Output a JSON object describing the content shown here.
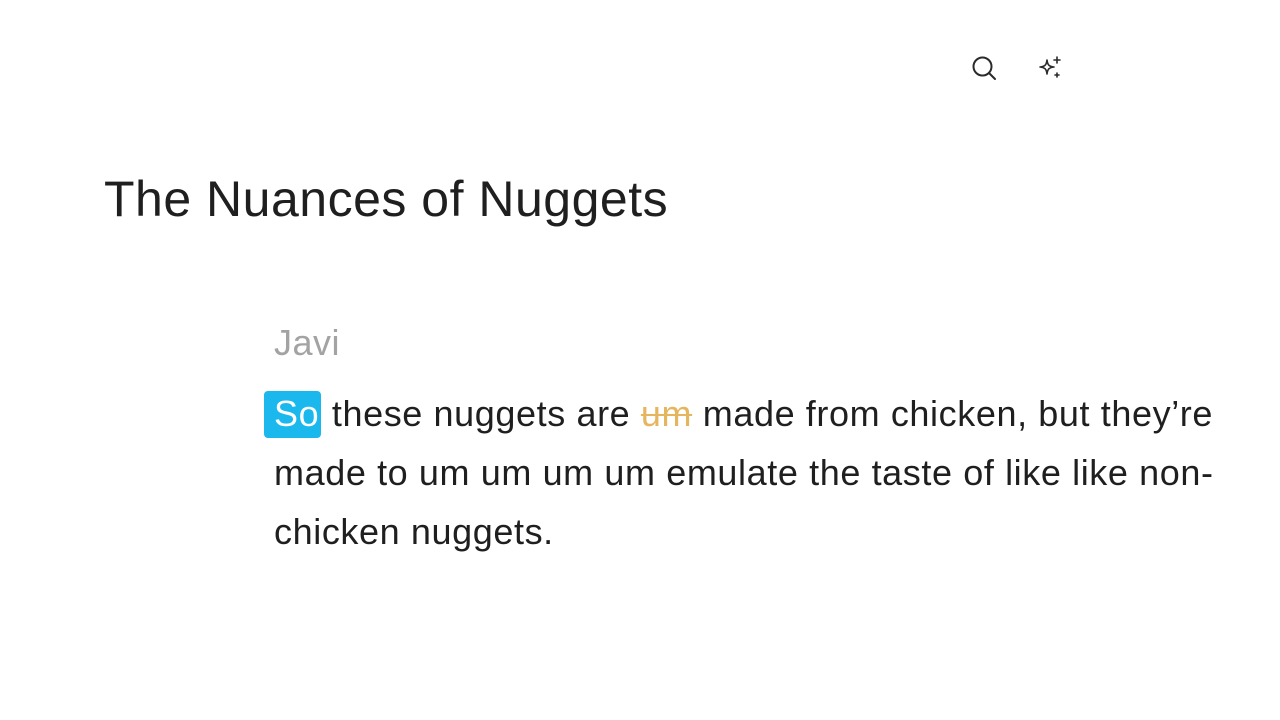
{
  "toolbar": {
    "search_icon": "search-icon",
    "ai_icon": "sparkle-icon"
  },
  "document": {
    "title": "The Nuances of Nuggets"
  },
  "transcript": {
    "speaker": "Javi",
    "words": [
      {
        "text": "So",
        "state": "selected"
      },
      {
        "text": "these",
        "state": "normal"
      },
      {
        "text": "nuggets",
        "state": "normal"
      },
      {
        "text": "are",
        "state": "normal"
      },
      {
        "text": "um",
        "state": "filler"
      },
      {
        "text": "made",
        "state": "normal"
      },
      {
        "text": "from",
        "state": "normal"
      },
      {
        "text": "chicken,",
        "state": "normal"
      },
      {
        "text": "but",
        "state": "normal"
      },
      {
        "text": "they’re",
        "state": "normal"
      },
      {
        "text": "made",
        "state": "normal"
      },
      {
        "text": "to",
        "state": "normal"
      },
      {
        "text": "um",
        "state": "normal"
      },
      {
        "text": "um",
        "state": "normal"
      },
      {
        "text": "um",
        "state": "normal"
      },
      {
        "text": "um",
        "state": "normal"
      },
      {
        "text": "emulate",
        "state": "normal"
      },
      {
        "text": "the",
        "state": "normal"
      },
      {
        "text": "taste",
        "state": "normal"
      },
      {
        "text": "of",
        "state": "normal"
      },
      {
        "text": "like",
        "state": "normal"
      },
      {
        "text": "like",
        "state": "normal"
      },
      {
        "text": "non-chicken",
        "state": "normal"
      },
      {
        "text": "nuggets.",
        "state": "normal"
      }
    ]
  },
  "colors": {
    "selection": "#1ab8ec",
    "filler": "#e6b65e",
    "speaker": "#a3a3a3",
    "text": "#1f1f1f"
  }
}
